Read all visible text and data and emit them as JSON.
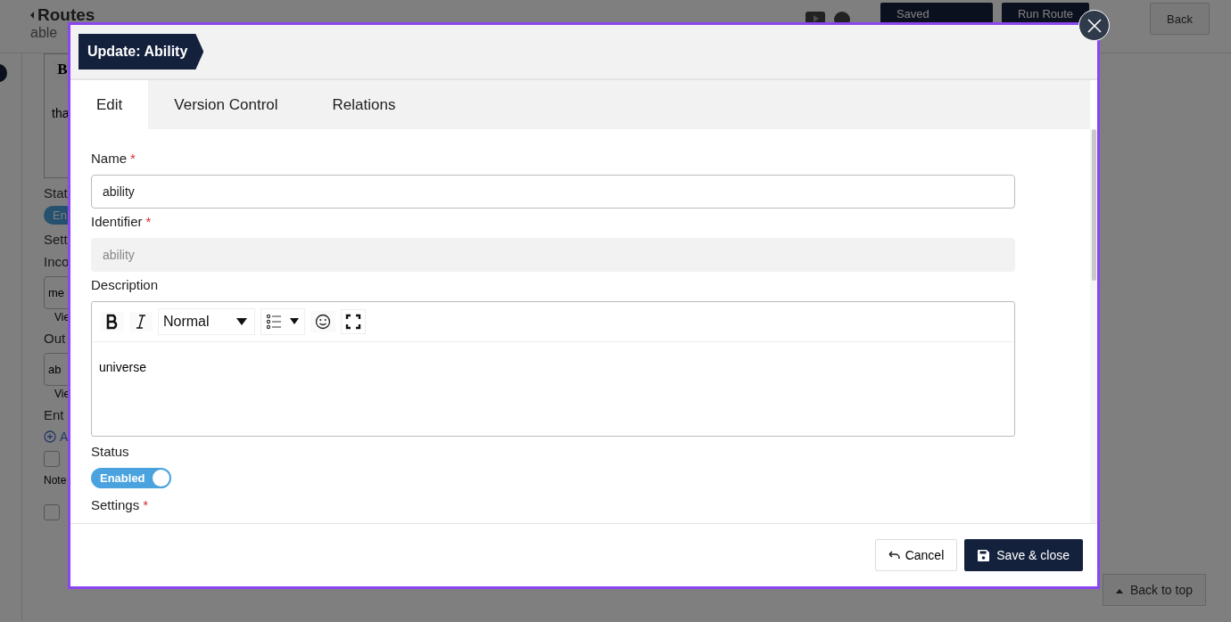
{
  "background": {
    "title": "Routes",
    "subtitle": "able",
    "header_buttons": [
      {
        "kind": "saved",
        "label": "Saved"
      },
      {
        "kind": "run",
        "label": "Run Route"
      },
      {
        "kind": "back",
        "label": "Back"
      }
    ],
    "editor_tool": "B",
    "editor_text": "tha",
    "side_items": [
      {
        "kind": "label",
        "text": "Stat"
      },
      {
        "kind": "pill",
        "text": "En"
      },
      {
        "kind": "label",
        "text": "Sett"
      },
      {
        "kind": "label",
        "text": "Inco"
      },
      {
        "kind": "field",
        "text": "me"
      },
      {
        "kind": "link",
        "text": "Vie"
      },
      {
        "kind": "label",
        "text": "Out"
      },
      {
        "kind": "field",
        "text": "ab"
      },
      {
        "kind": "link",
        "text": "Vie"
      },
      {
        "kind": "label",
        "text": "Ent"
      },
      {
        "kind": "add",
        "text": "A"
      },
      {
        "kind": "checkbox",
        "checked": false
      },
      {
        "kind": "note",
        "text": "Note"
      },
      {
        "kind": "checkbox",
        "checked": false
      }
    ],
    "back_to_top": "Back to top"
  },
  "modal": {
    "title": "Update: Ability",
    "tabs": [
      {
        "label": "Edit",
        "selected": true
      },
      {
        "label": "Version Control",
        "selected": false
      },
      {
        "label": "Relations",
        "selected": false
      }
    ],
    "fields": [
      {
        "kind": "text",
        "label": "Name",
        "required_mark": "*",
        "value": "ability",
        "disabled": false
      },
      {
        "kind": "text",
        "label": "Identifier",
        "required_mark": "*",
        "value": "ability",
        "disabled": true
      },
      {
        "kind": "editor",
        "label": "Description",
        "value": "universe",
        "format": "Normal"
      },
      {
        "kind": "toggle",
        "label": "Status",
        "on": true,
        "value": "Enabled"
      },
      {
        "kind": "heading",
        "label": "Settings",
        "required_mark": "*"
      }
    ],
    "cancel": "Cancel",
    "save": "Save & close"
  }
}
